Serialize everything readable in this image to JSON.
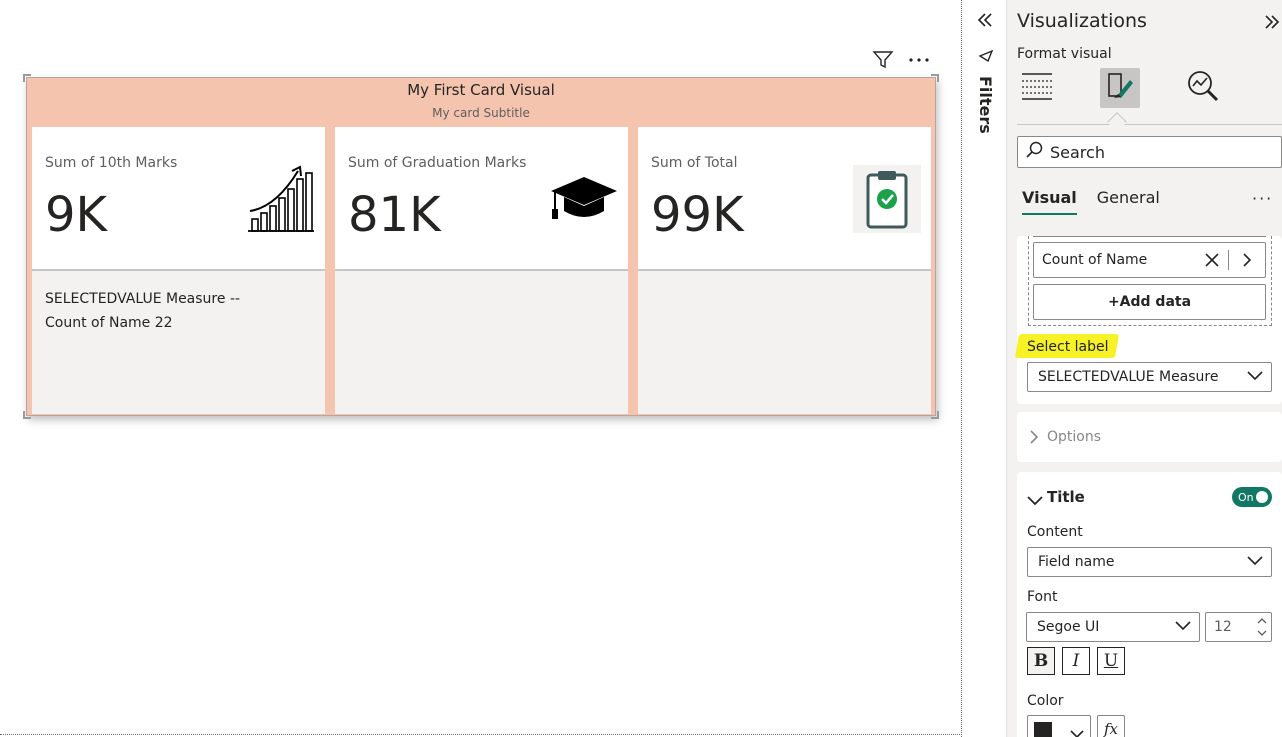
{
  "canvas": {
    "visual": {
      "title": "My First Card Visual",
      "subtitle": "My card Subtitle",
      "cards": [
        {
          "label": "Sum of 10th Marks",
          "value": "9K",
          "reference": "SELECTEDVALUE Measure --",
          "reference2": "Count of Name 22",
          "icon": "growth-chart-icon"
        },
        {
          "label": "Sum of Graduation Marks",
          "value": "81K",
          "icon": "graduation-cap-icon"
        },
        {
          "label": "Sum of Total",
          "value": "99K",
          "icon": "clipboard-check-icon"
        }
      ],
      "colors": {
        "background": "#f4c4ae",
        "card": "#ffffff",
        "reference": "#f3f2f1"
      }
    }
  },
  "filters": {
    "label": "Filters"
  },
  "visualizations": {
    "title": "Visualizations",
    "format_visual": "Format visual",
    "search_placeholder": "Search",
    "tabs": [
      "Visual",
      "General"
    ],
    "field_well": {
      "field": "Count of Name",
      "add_data": "+Add data"
    },
    "select_label": {
      "label": "Select label",
      "value": "SELECTEDVALUE Measure"
    },
    "options": {
      "label": "Options"
    },
    "title_section": {
      "label": "Title",
      "toggle": "On",
      "content_label": "Content",
      "content_value": "Field name",
      "font_label": "Font",
      "font_value": "Segoe UI",
      "font_size": "12",
      "bold": "B",
      "italic": "I",
      "underline": "U",
      "color_label": "Color",
      "fx": "fx"
    },
    "accent_color": "#117865"
  }
}
